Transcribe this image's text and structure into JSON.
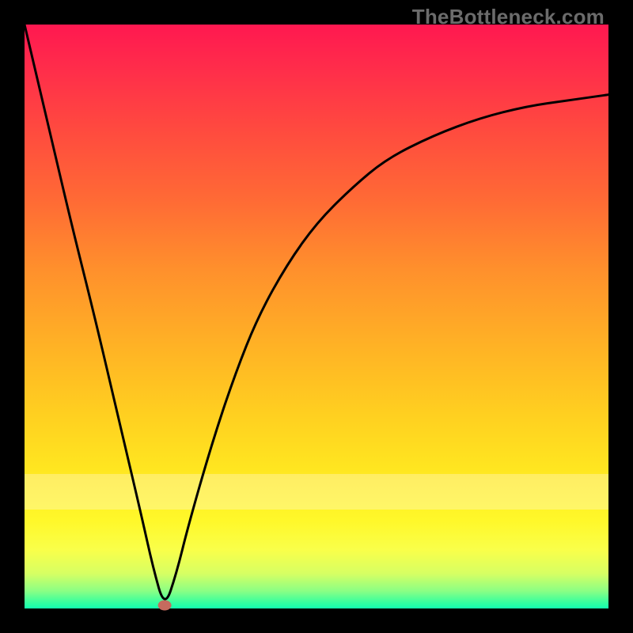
{
  "watermark": "TheBottleneck.com",
  "chart_data": {
    "type": "line",
    "title": "",
    "xlabel": "",
    "ylabel": "",
    "xlim": [
      0,
      1
    ],
    "ylim": [
      0,
      1
    ],
    "legend": false,
    "grid": false,
    "background": "rainbow-gradient-red-to-green",
    "minimum_point": {
      "x": 0.24,
      "y": 0.0
    },
    "series": [
      {
        "name": "bottleneck-curve",
        "x": [
          0.0,
          0.04,
          0.08,
          0.12,
          0.16,
          0.2,
          0.22,
          0.24,
          0.26,
          0.28,
          0.32,
          0.36,
          0.4,
          0.45,
          0.5,
          0.56,
          0.62,
          0.7,
          0.78,
          0.86,
          0.93,
          1.0
        ],
        "y": [
          1.0,
          0.83,
          0.66,
          0.5,
          0.33,
          0.16,
          0.07,
          0.0,
          0.06,
          0.14,
          0.28,
          0.4,
          0.5,
          0.59,
          0.66,
          0.72,
          0.77,
          0.81,
          0.84,
          0.86,
          0.87,
          0.88
        ]
      }
    ],
    "marker": {
      "x": 0.24,
      "y": 0.0,
      "color": "#c56b5e",
      "shape": "ellipse"
    },
    "pink_band_y": [
      0.17,
      0.23
    ]
  },
  "colors": {
    "curve": "#000000",
    "marker": "#c56b5e",
    "frame": "#000000"
  }
}
